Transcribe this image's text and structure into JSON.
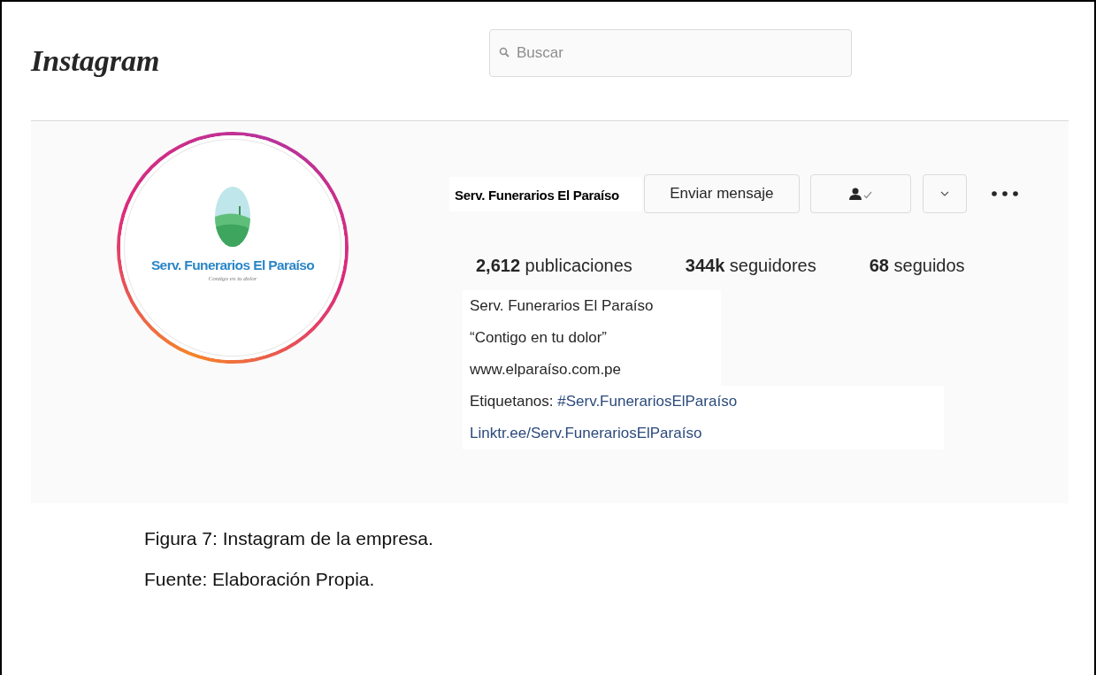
{
  "header": {
    "logo": "Instagram",
    "search": {
      "placeholder": "Buscar"
    }
  },
  "profile": {
    "avatar": {
      "logo_name": "Serv. Funerarios El Paraíso",
      "logo_tagline": "Contigo en tu dolor"
    },
    "username": "Serv. Funerarios El Paraíso",
    "buttons": [
      {
        "kind": "text",
        "label": "Enviar mensaje"
      },
      {
        "kind": "following"
      },
      {
        "kind": "caret"
      },
      {
        "kind": "more"
      }
    ],
    "stats": [
      {
        "count": "2,612",
        "label": "publicaciones"
      },
      {
        "count": "344k",
        "label": "seguidores"
      },
      {
        "count": "68",
        "label": "seguidos"
      }
    ],
    "bio": [
      {
        "kind": "text",
        "text": "Serv. Funerarios El Paraíso"
      },
      {
        "kind": "text",
        "text": "“Contigo en tu dolor”"
      },
      {
        "kind": "text",
        "text": "www.elparaíso.com.pe"
      },
      {
        "kind": "tag",
        "text": "Etiquetanos:",
        "tag": "#Serv.FunerariosElParaíso"
      },
      {
        "kind": "link",
        "text": "Linktr.ee/Serv.FunerariosElParaíso"
      }
    ]
  },
  "caption": [
    "Figura 7: Instagram de la empresa.",
    "Fuente: Elaboración Propia."
  ]
}
